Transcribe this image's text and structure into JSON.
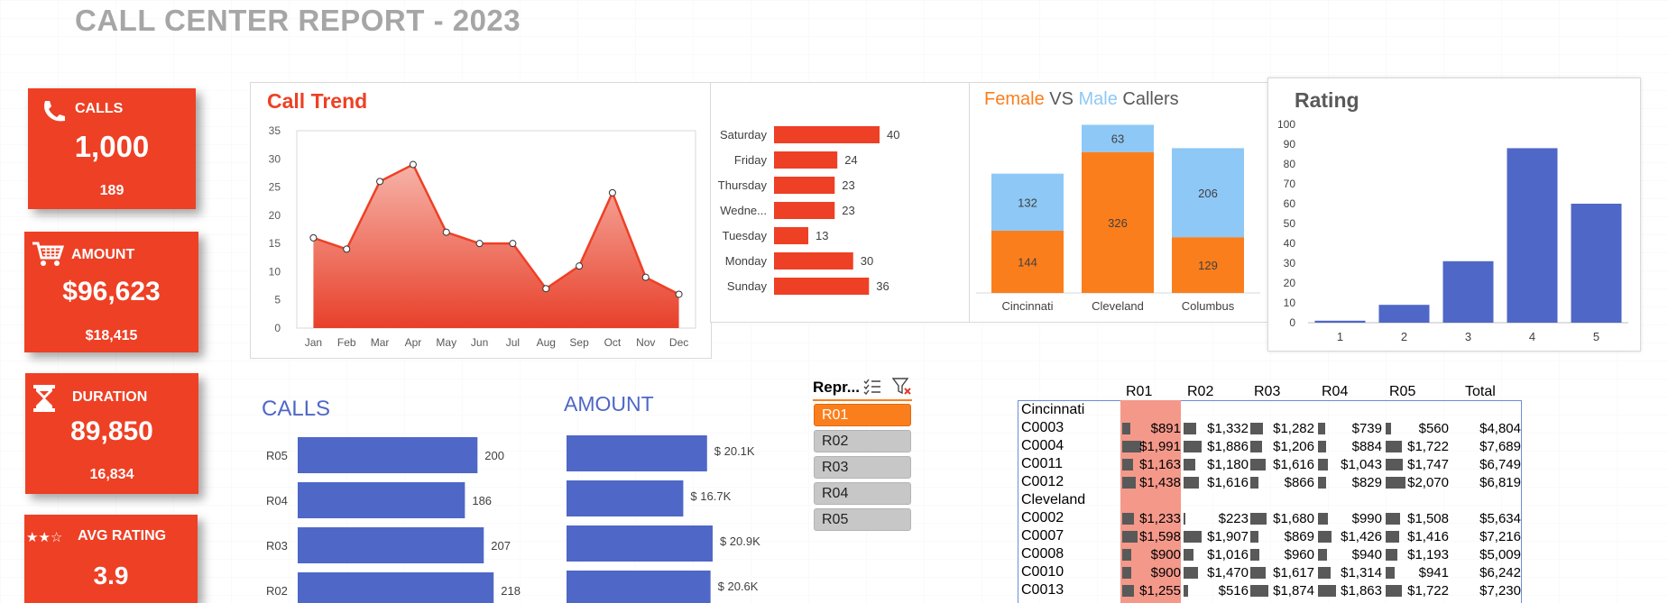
{
  "report": {
    "title": "CALL CENTER REPORT - 2023"
  },
  "kpis": {
    "calls": {
      "label": "CALLS",
      "value": "1,000",
      "sub": "189",
      "icon": "phone-icon"
    },
    "amount": {
      "label": "AMOUNT",
      "value": "$96,623",
      "sub": "$18,415",
      "icon": "cart-icon"
    },
    "duration": {
      "label": "DURATION",
      "value": "89,850",
      "sub": "16,834",
      "icon": "hourglass-icon"
    },
    "avg_rating": {
      "label": "AVG RATING",
      "value": "3.9",
      "stars": "★★☆",
      "icon": "star-icon"
    }
  },
  "colors": {
    "accent": "#ee4025",
    "blue": "#4f67c7",
    "orange": "#fb7e1c",
    "lightblue": "#8ec8f6",
    "slicer_selected": "#fb7e1c"
  },
  "call_trend": {
    "title": "Call Trend",
    "chart_data": {
      "type": "area",
      "categories": [
        "Jan",
        "Feb",
        "Mar",
        "Apr",
        "May",
        "Jun",
        "Jul",
        "Aug",
        "Sep",
        "Oct",
        "Nov",
        "Dec"
      ],
      "values": [
        16,
        14,
        26,
        29,
        17,
        15,
        15,
        7,
        11,
        24,
        9,
        6
      ],
      "ylim": [
        0,
        35
      ],
      "yticks": [
        0,
        5,
        10,
        15,
        20,
        25,
        30,
        35
      ]
    }
  },
  "weekday_chart": {
    "chart_data": {
      "type": "bar",
      "orientation": "horizontal",
      "categories": [
        "Saturday",
        "Friday",
        "Thursday",
        "Wedne...",
        "Tuesday",
        "Monday",
        "Sunday"
      ],
      "values": [
        40,
        24,
        23,
        23,
        13,
        30,
        36
      ]
    }
  },
  "gender_chart": {
    "title_parts": [
      "Female",
      " VS ",
      "Male",
      " Callers"
    ],
    "chart_data": {
      "type": "bar",
      "stacked": true,
      "categories": [
        "Cincinnati",
        "Cleveland",
        "Columbus"
      ],
      "series": [
        {
          "values": [
            144,
            326,
            129
          ],
          "color": "#fb7e1c"
        },
        {
          "values": [
            132,
            63,
            206
          ],
          "color": "#8ec8f6"
        }
      ]
    }
  },
  "rating_chart": {
    "title": "Rating",
    "chart_data": {
      "type": "bar",
      "categories": [
        "1",
        "2",
        "3",
        "4",
        "5"
      ],
      "values": [
        1,
        9,
        31,
        88,
        60
      ],
      "ylim": [
        0,
        100
      ],
      "yticks": [
        0,
        10,
        20,
        30,
        40,
        50,
        60,
        70,
        80,
        90,
        100
      ]
    }
  },
  "calls_by_rep": {
    "title": "CALLS",
    "chart_data": {
      "type": "bar",
      "orientation": "horizontal",
      "categories": [
        "R05",
        "R04",
        "R03",
        "R02"
      ],
      "values": [
        200,
        186,
        207,
        218
      ]
    }
  },
  "amount_by_rep": {
    "title": "AMOUNT",
    "chart_data": {
      "type": "bar",
      "orientation": "horizontal",
      "categories": [
        "R05",
        "R04",
        "R03",
        "R02"
      ],
      "values": [
        20.1,
        16.7,
        20.9,
        20.6
      ],
      "labels": [
        "$ 20.1K",
        "$ 16.7K",
        "$ 20.9K",
        "$ 20.6K"
      ]
    }
  },
  "slicer": {
    "header": "Repr...",
    "items": [
      "R01",
      "R02",
      "R03",
      "R04",
      "R05"
    ],
    "selected": "R01"
  },
  "pivot": {
    "columns": [
      "R01",
      "R02",
      "R03",
      "R04",
      "R05",
      "Total"
    ],
    "groups": [
      {
        "name": "Cincinnati",
        "rows": [
          {
            "id": "C0003",
            "values": [
              "$891",
              "$1,332",
              "$1,282",
              "$739",
              "$560",
              "$4,804"
            ],
            "nums": [
              891,
              1332,
              1282,
              739,
              560
            ]
          },
          {
            "id": "C0004",
            "values": [
              "$1,991",
              "$1,886",
              "$1,206",
              "$884",
              "$1,722",
              "$7,689"
            ],
            "nums": [
              1991,
              1886,
              1206,
              884,
              1722
            ]
          },
          {
            "id": "C0011",
            "values": [
              "$1,163",
              "$1,180",
              "$1,616",
              "$1,043",
              "$1,747",
              "$6,749"
            ],
            "nums": [
              1163,
              1180,
              1616,
              1043,
              1747
            ]
          },
          {
            "id": "C0012",
            "values": [
              "$1,438",
              "$1,616",
              "$866",
              "$829",
              "$2,070",
              "$6,819"
            ],
            "nums": [
              1438,
              1616,
              866,
              829,
              2070
            ]
          }
        ]
      },
      {
        "name": "Cleveland",
        "rows": [
          {
            "id": "C0002",
            "values": [
              "$1,233",
              "$223",
              "$1,680",
              "$990",
              "$1,508",
              "$5,634"
            ],
            "nums": [
              1233,
              223,
              1680,
              990,
              1508
            ]
          },
          {
            "id": "C0007",
            "values": [
              "$1,598",
              "$1,907",
              "$869",
              "$1,426",
              "$1,416",
              "$7,216"
            ],
            "nums": [
              1598,
              1907,
              869,
              1426,
              1416
            ]
          },
          {
            "id": "C0008",
            "values": [
              "$900",
              "$1,016",
              "$960",
              "$940",
              "$1,193",
              "$5,009"
            ],
            "nums": [
              900,
              1016,
              960,
              940,
              1193
            ]
          },
          {
            "id": "C0010",
            "values": [
              "$900",
              "$1,470",
              "$1,617",
              "$1,314",
              "$941",
              "$6,242"
            ],
            "nums": [
              900,
              1470,
              1617,
              1314,
              941
            ]
          },
          {
            "id": "C0013",
            "values": [
              "$1,255",
              "$516",
              "$1,874",
              "$1,863",
              "$1,722",
              "$7,230"
            ],
            "nums": [
              1255,
              516,
              1874,
              1863,
              1722
            ]
          }
        ]
      }
    ]
  }
}
